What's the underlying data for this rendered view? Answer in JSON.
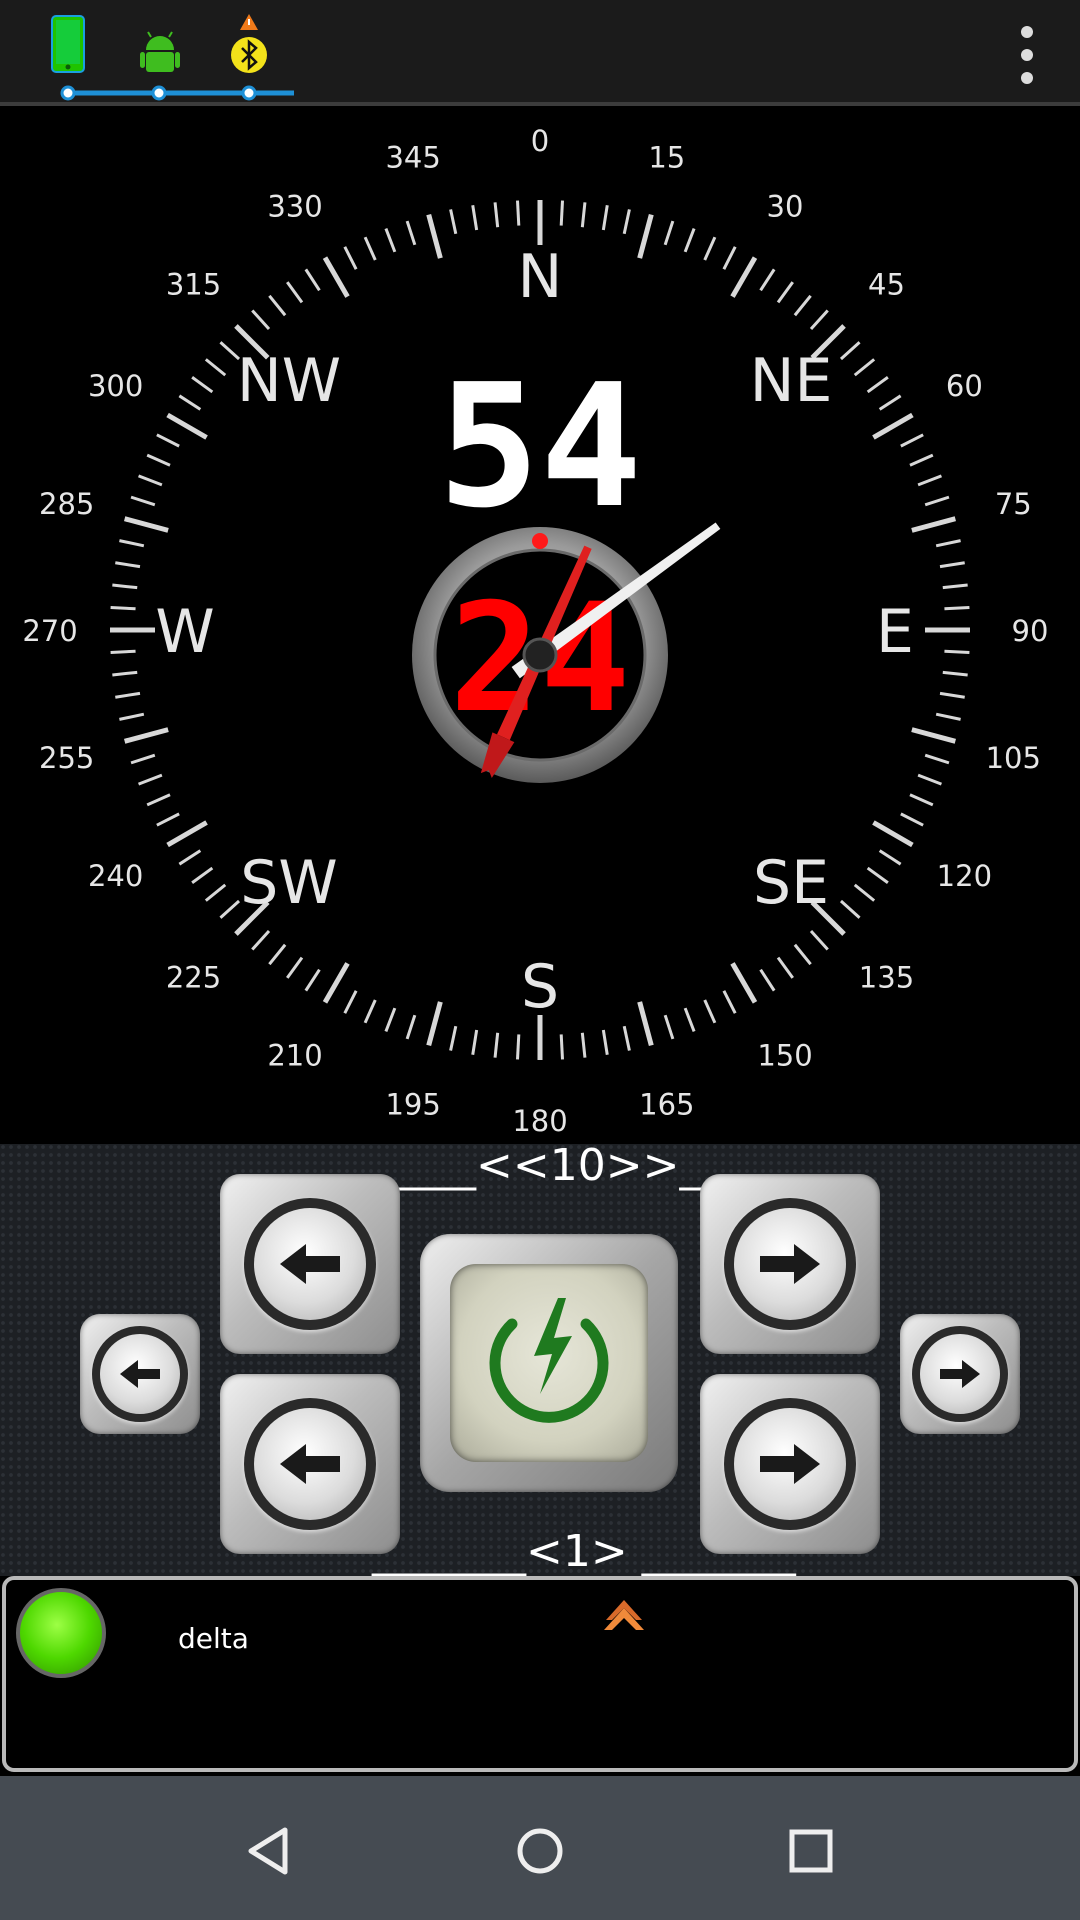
{
  "status_icons": [
    {
      "name": "phone-icon"
    },
    {
      "name": "android-icon"
    },
    {
      "name": "bluetooth-warning-icon"
    }
  ],
  "menu": {
    "icon": "overflow-menu-icon"
  },
  "compass": {
    "heading_display": "54",
    "secondary_display": "24",
    "heading_degrees": 54,
    "needle_degrees": 24,
    "degree_labels": [
      "0",
      "15",
      "30",
      "45",
      "60",
      "75",
      "90",
      "105",
      "120",
      "135",
      "150",
      "165",
      "180",
      "195",
      "210",
      "225",
      "240",
      "255",
      "270",
      "285",
      "300",
      "315",
      "330",
      "345"
    ],
    "cardinal_labels": [
      "N",
      "NE",
      "E",
      "SE",
      "S",
      "SW",
      "W",
      "NW"
    ]
  },
  "controls": {
    "step_large_label": "______<<10>>______",
    "step_small_label": "_______<1> _______",
    "buttons": {
      "left_small": "left-arrow-small-button",
      "left_upper": "left-arrow-button",
      "left_lower": "left-arrow-button",
      "power": "power-button",
      "right_upper": "right-arrow-button",
      "right_lower": "right-arrow-button",
      "right_small": "right-arrow-small-button"
    }
  },
  "status_panel": {
    "device_name": "delta",
    "led_color": "#4ed800",
    "marker_color": "#f08a3a"
  },
  "colors": {
    "needle": "#e0201f",
    "power_icon": "#1f7a1f",
    "status_line": "#1e90d6"
  }
}
